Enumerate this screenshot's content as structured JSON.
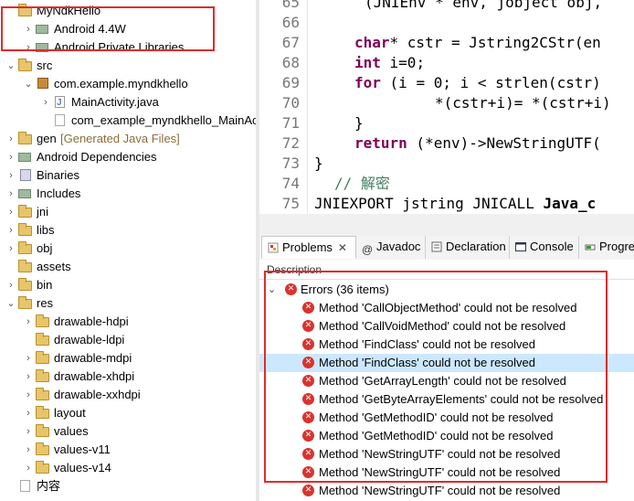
{
  "tree": {
    "items": [
      {
        "label": "MyNdkHello",
        "twisty": "",
        "icon": "project-icon"
      },
      {
        "label": "Android 4.4W",
        "twisty": "›",
        "icon": "library-icon"
      },
      {
        "label": "Android Private Libraries",
        "twisty": "›",
        "icon": "library-icon"
      },
      {
        "label": "src",
        "twisty": "⌄",
        "icon": "source-folder-icon"
      },
      {
        "label": "com.example.myndkhello",
        "twisty": "⌄",
        "icon": "package-icon"
      },
      {
        "label": "MainActivity.java",
        "twisty": "›",
        "icon": "java-file-icon"
      },
      {
        "label": "com_example_myndkhello_MainActivi",
        "twisty": "",
        "icon": "header-file-icon"
      },
      {
        "label": "gen",
        "decoration": "[Generated Java Files]",
        "twisty": "›",
        "icon": "source-folder-icon"
      },
      {
        "label": "Android Dependencies",
        "twisty": "›",
        "icon": "library-icon"
      },
      {
        "label": "Binaries",
        "twisty": "›",
        "icon": "binaries-icon"
      },
      {
        "label": "Includes",
        "twisty": "›",
        "icon": "includes-icon"
      },
      {
        "label": "jni",
        "twisty": "›",
        "icon": "folder-icon"
      },
      {
        "label": "libs",
        "twisty": "›",
        "icon": "folder-icon"
      },
      {
        "label": "obj",
        "twisty": "›",
        "icon": "folder-icon"
      },
      {
        "label": "assets",
        "twisty": "",
        "icon": "folder-icon"
      },
      {
        "label": "bin",
        "twisty": "›",
        "icon": "folder-icon"
      },
      {
        "label": "res",
        "twisty": "⌄",
        "icon": "folder-icon"
      },
      {
        "label": "drawable-hdpi",
        "twisty": "›",
        "icon": "folder-icon"
      },
      {
        "label": "drawable-ldpi",
        "twisty": "",
        "icon": "folder-icon"
      },
      {
        "label": "drawable-mdpi",
        "twisty": "›",
        "icon": "folder-icon"
      },
      {
        "label": "drawable-xhdpi",
        "twisty": "›",
        "icon": "folder-icon"
      },
      {
        "label": "drawable-xxhdpi",
        "twisty": "›",
        "icon": "folder-icon"
      },
      {
        "label": "layout",
        "twisty": "›",
        "icon": "folder-icon"
      },
      {
        "label": "values",
        "twisty": "›",
        "icon": "folder-icon"
      },
      {
        "label": "values-v11",
        "twisty": "›",
        "icon": "folder-icon"
      },
      {
        "label": "values-v14",
        "twisty": "›",
        "icon": "folder-icon"
      },
      {
        "label": "内容",
        "twisty": "",
        "icon": "text-file-icon"
      }
    ]
  },
  "editor": {
    "line_numbers": [
      "65",
      "66",
      "67",
      "68",
      "69",
      "70",
      "71",
      "72",
      "73",
      "74",
      "75"
    ],
    "lines": {
      "l65": "(JNIEnv * env, jobject obj,",
      "l67_kw": "char",
      "l67_rest": "* cstr = Jstring2CStr(en",
      "l68_kw": "int",
      "l68_rest": " i=0;",
      "l69_kw": "for",
      "l69_rest": " (i = 0; i < strlen(cstr)",
      "l70": "*(cstr+i)= *(cstr+i)",
      "l71": "}",
      "l72_kw": "return",
      "l72_rest": " (*env)->NewStringUTF(",
      "l73": "}",
      "l74": "// 解密",
      "l75_pre": "JNIEXPORT jstring JNICALL ",
      "l75_bold": "Java_c"
    }
  },
  "views": {
    "tabs": [
      {
        "label": "Problems",
        "icon": "problems-icon"
      },
      {
        "label": "Javadoc",
        "icon": "javadoc-icon"
      },
      {
        "label": "Declaration",
        "icon": "declaration-icon"
      },
      {
        "label": "Console",
        "icon": "console-icon"
      },
      {
        "label": "Progre",
        "icon": "progress-icon"
      }
    ],
    "close_glyph": "✕"
  },
  "problems": {
    "column_header": "Description",
    "group_label": "Errors (36 items)",
    "errors": [
      "Method 'CallObjectMethod' could not be resolved",
      "Method 'CallVoidMethod' could not be resolved",
      "Method 'FindClass' could not be resolved",
      "Method 'FindClass' could not be resolved",
      "Method 'GetArrayLength' could not be resolved",
      "Method 'GetByteArrayElements' could not be resolved",
      "Method 'GetMethodID' could not be resolved",
      "Method 'GetMethodID' could not be resolved",
      "Method 'NewStringUTF' could not be resolved",
      "Method 'NewStringUTF' could not be resolved",
      "Method 'NewStringUTF' could not be resolved"
    ],
    "highlighted_index": 3
  },
  "colors": {
    "annotation_red": "#e02b2b",
    "keyword": "#7f0055",
    "comment": "#3f7f5f",
    "error": "#d9332f",
    "selection": "#cce8ff"
  }
}
